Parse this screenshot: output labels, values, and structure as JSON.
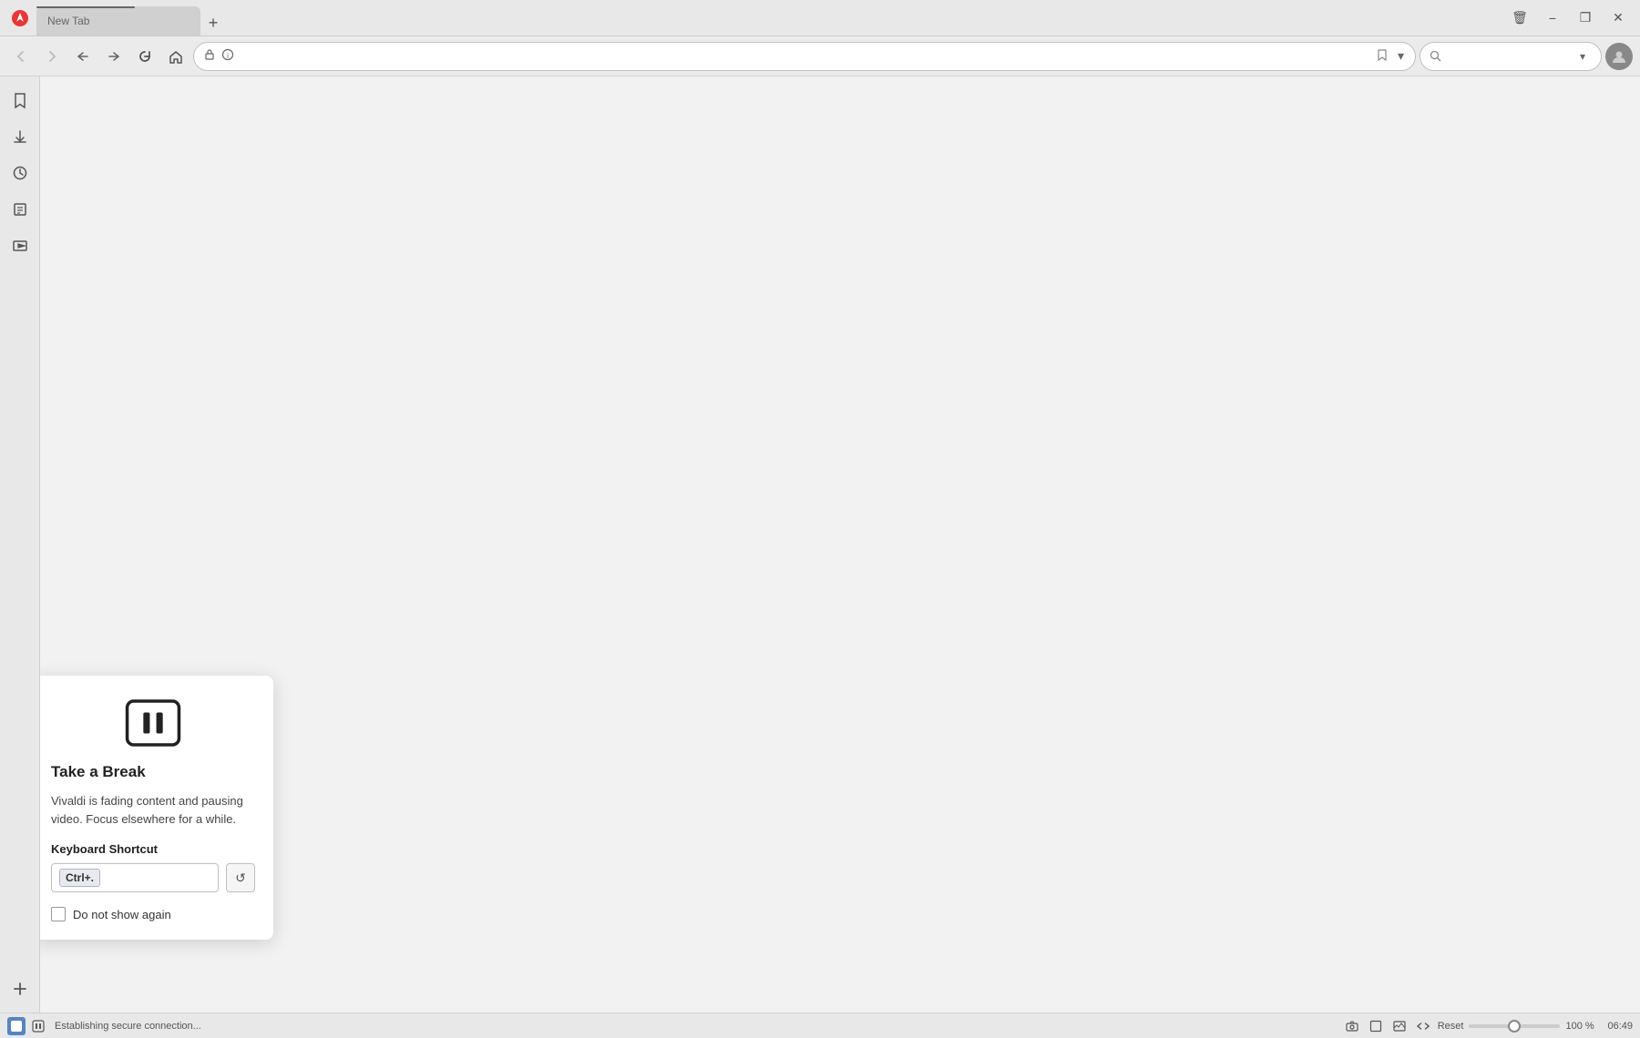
{
  "titleBar": {
    "tab": {
      "label": "",
      "loading": true
    },
    "newTabBtn": "+",
    "windowControls": {
      "trash": "🗑",
      "minimize": "−",
      "maximize": "❐",
      "close": "✕"
    }
  },
  "navBar": {
    "backBtn": "←",
    "forwardBtn": "→",
    "rewindBtn": "⏮",
    "fastForwardBtn": "⏭",
    "reloadBtn": "↻",
    "homeBtn": "⌂",
    "shieldIcon": "🛡",
    "infoIcon": "ⓘ",
    "addressPlaceholder": "",
    "bookmarkIcon": "🔖",
    "searchPlaceholder": "",
    "avatarIcon": "👤"
  },
  "sidebar": {
    "items": [
      {
        "name": "bookmarks",
        "icon": "🔖"
      },
      {
        "name": "downloads",
        "icon": "⬇"
      },
      {
        "name": "history",
        "icon": "⏱"
      },
      {
        "name": "notes",
        "icon": "📋"
      },
      {
        "name": "capture",
        "icon": "🎬"
      }
    ],
    "addBtn": "+"
  },
  "popup": {
    "title": "Take a Break",
    "description": "Vivaldi is fading content and pausing video. Focus elsewhere for a while.",
    "shortcutLabel": "Keyboard Shortcut",
    "shortcutKey": "Ctrl+.",
    "shortcutPlaceholder": "",
    "resetBtn": "↺",
    "doNotShowLabel": "Do not show again"
  },
  "statusBar": {
    "connectionText": "Establishing secure connection...",
    "zoomResetLabel": "Reset",
    "zoomPercent": "100 %",
    "time": "06:49",
    "icons": {
      "camera": "📷",
      "window": "☐",
      "image": "🖼",
      "code": "<>"
    }
  }
}
